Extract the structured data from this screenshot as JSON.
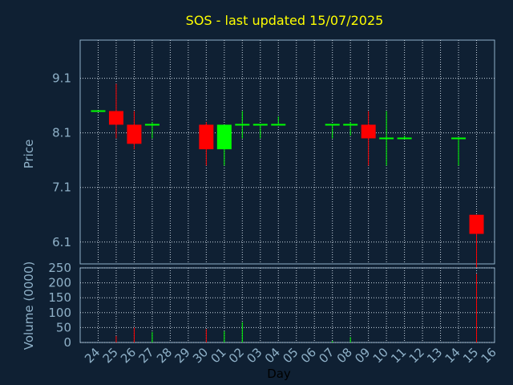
{
  "chart_data": {
    "type": "candlestick",
    "title": "SOS - last updated 15/07/2025",
    "xlabel": "Day",
    "price_panel": {
      "ylabel": "Price",
      "yticks": [
        "6.1",
        "7.1",
        "8.1",
        "9.1"
      ],
      "ylim": [
        5.7,
        9.8
      ],
      "grid": true
    },
    "volume_panel": {
      "ylabel": "Volume (0000)",
      "yticks": [
        "0",
        "50",
        "100",
        "150",
        "200",
        "250"
      ],
      "ylim": [
        0,
        250
      ],
      "grid": true
    },
    "x_tick_labels": [
      "24",
      "25",
      "26",
      "27",
      "28",
      "29",
      "30",
      "01",
      "02",
      "03",
      "04",
      "05",
      "06",
      "07",
      "08",
      "09",
      "10",
      "11",
      "12",
      "13",
      "14",
      "15",
      "16"
    ],
    "candles": [
      {
        "day": "24",
        "open": 8.5,
        "high": 8.5,
        "low": 8.5,
        "close": 8.5,
        "volume": 0
      },
      {
        "day": "25",
        "open": 8.5,
        "high": 9.0,
        "low": 8.0,
        "close": 8.25,
        "volume": 22
      },
      {
        "day": "26",
        "open": 8.25,
        "high": 8.5,
        "low": 7.8,
        "close": 7.9,
        "volume": 50
      },
      {
        "day": "27",
        "open": 8.25,
        "high": 8.3,
        "low": 8.0,
        "close": 8.25,
        "volume": 35
      },
      {
        "day": "30",
        "open": 8.25,
        "high": 8.3,
        "low": 7.5,
        "close": 7.8,
        "volume": 45
      },
      {
        "day": "01",
        "open": 7.8,
        "high": 8.25,
        "low": 7.5,
        "close": 8.25,
        "volume": 38
      },
      {
        "day": "02",
        "open": 8.25,
        "high": 8.5,
        "low": 8.0,
        "close": 8.25,
        "volume": 68
      },
      {
        "day": "03",
        "open": 8.25,
        "high": 8.25,
        "low": 8.0,
        "close": 8.25,
        "volume": 0
      },
      {
        "day": "04",
        "open": 8.25,
        "high": 8.4,
        "low": 8.25,
        "close": 8.25,
        "volume": 0
      },
      {
        "day": "07",
        "open": 8.25,
        "high": 8.25,
        "low": 8.0,
        "close": 8.25,
        "volume": 5
      },
      {
        "day": "08",
        "open": 8.25,
        "high": 8.3,
        "low": 8.05,
        "close": 8.25,
        "volume": 18
      },
      {
        "day": "09",
        "open": 8.25,
        "high": 8.5,
        "low": 7.5,
        "close": 8.0,
        "volume": 0
      },
      {
        "day": "10",
        "open": 8.0,
        "high": 8.5,
        "low": 7.5,
        "close": 8.0,
        "volume": 0
      },
      {
        "day": "11",
        "open": 8.0,
        "high": 8.05,
        "low": 8.0,
        "close": 8.0,
        "volume": 0
      },
      {
        "day": "14",
        "open": 8.0,
        "high": 8.0,
        "low": 7.5,
        "close": 8.0,
        "volume": 0
      },
      {
        "day": "15",
        "open": 6.6,
        "high": 6.6,
        "low": 5.6,
        "close": 6.25,
        "volume": 230
      }
    ],
    "colors": {
      "background": "#0f2033",
      "plot_border": "#8fb1c8",
      "grid": "#c8d4e0",
      "up": "#00ff00",
      "down": "#ff0000",
      "title": "#ffff00",
      "tick_text": "#8fb1c8"
    }
  }
}
